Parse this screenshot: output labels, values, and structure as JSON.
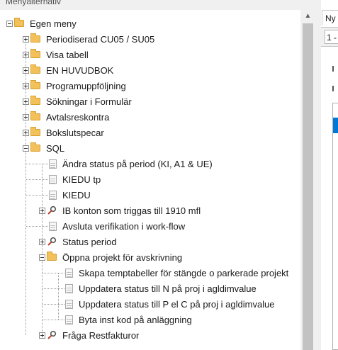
{
  "panel": {
    "title": "Menyalternativ"
  },
  "tree": {
    "items": [
      {
        "label": "Egen meny",
        "icon": "folder-icon",
        "expander": "minus",
        "level": 0
      },
      {
        "label": "Periodiserad CU05 / SU05",
        "icon": "folder-icon",
        "expander": "plus",
        "level": 1
      },
      {
        "label": "Visa tabell",
        "icon": "folder-icon",
        "expander": "plus",
        "level": 1
      },
      {
        "label": "EN HUVUDBOK",
        "icon": "folder-icon",
        "expander": "plus",
        "level": 1
      },
      {
        "label": "Programuppföljning",
        "icon": "folder-icon",
        "expander": "plus",
        "level": 1
      },
      {
        "label": "Sökningar i Formulär",
        "icon": "folder-icon",
        "expander": "plus",
        "level": 1
      },
      {
        "label": "Avtalsreskontra",
        "icon": "folder-icon",
        "expander": "plus",
        "level": 1
      },
      {
        "label": "Bokslutspecar",
        "icon": "folder-icon",
        "expander": "plus",
        "level": 1
      },
      {
        "label": "SQL",
        "icon": "folder-icon",
        "expander": "minus",
        "level": 1
      },
      {
        "label": "Ändra status på period (KI, A1 & UE)",
        "icon": "document-icon",
        "expander": "none",
        "level": 2
      },
      {
        "label": "KIEDU tp",
        "icon": "document-icon",
        "expander": "none",
        "level": 2
      },
      {
        "label": "KIEDU",
        "icon": "document-icon",
        "expander": "none",
        "level": 2
      },
      {
        "label": "IB konton som triggas till 1910 mfl",
        "icon": "search-icon",
        "expander": "plus",
        "level": 2
      },
      {
        "label": "Avsluta verifikation i work-flow",
        "icon": "document-icon",
        "expander": "none",
        "level": 2
      },
      {
        "label": "Status period",
        "icon": "search-icon",
        "expander": "plus",
        "level": 2
      },
      {
        "label": "Öppna projekt för avskrivning",
        "icon": "folder-icon",
        "expander": "minus",
        "level": 2
      },
      {
        "label": "Skapa temptabeller för stängde o parkerade projekt",
        "icon": "document-icon",
        "expander": "none",
        "level": 3
      },
      {
        "label": "Uppdatera status till N på proj i agldimvalue",
        "icon": "document-icon",
        "expander": "none",
        "level": 3
      },
      {
        "label": "Uppdatera status till P el C på proj i agldimvalue",
        "icon": "document-icon",
        "expander": "none",
        "level": 3
      },
      {
        "label": "Byta inst kod på anläggning",
        "icon": "document-icon",
        "expander": "none",
        "level": 3
      },
      {
        "label": "Fråga Restfakturor",
        "icon": "search-icon",
        "expander": "plus",
        "level": 2
      }
    ]
  },
  "right_pane": {
    "tab_label": "Ny",
    "field_value": "1 -"
  },
  "colors": {
    "selection": "#0078d7",
    "folder": "#f3c15b",
    "scroll_thumb": "#c2c2c2"
  }
}
